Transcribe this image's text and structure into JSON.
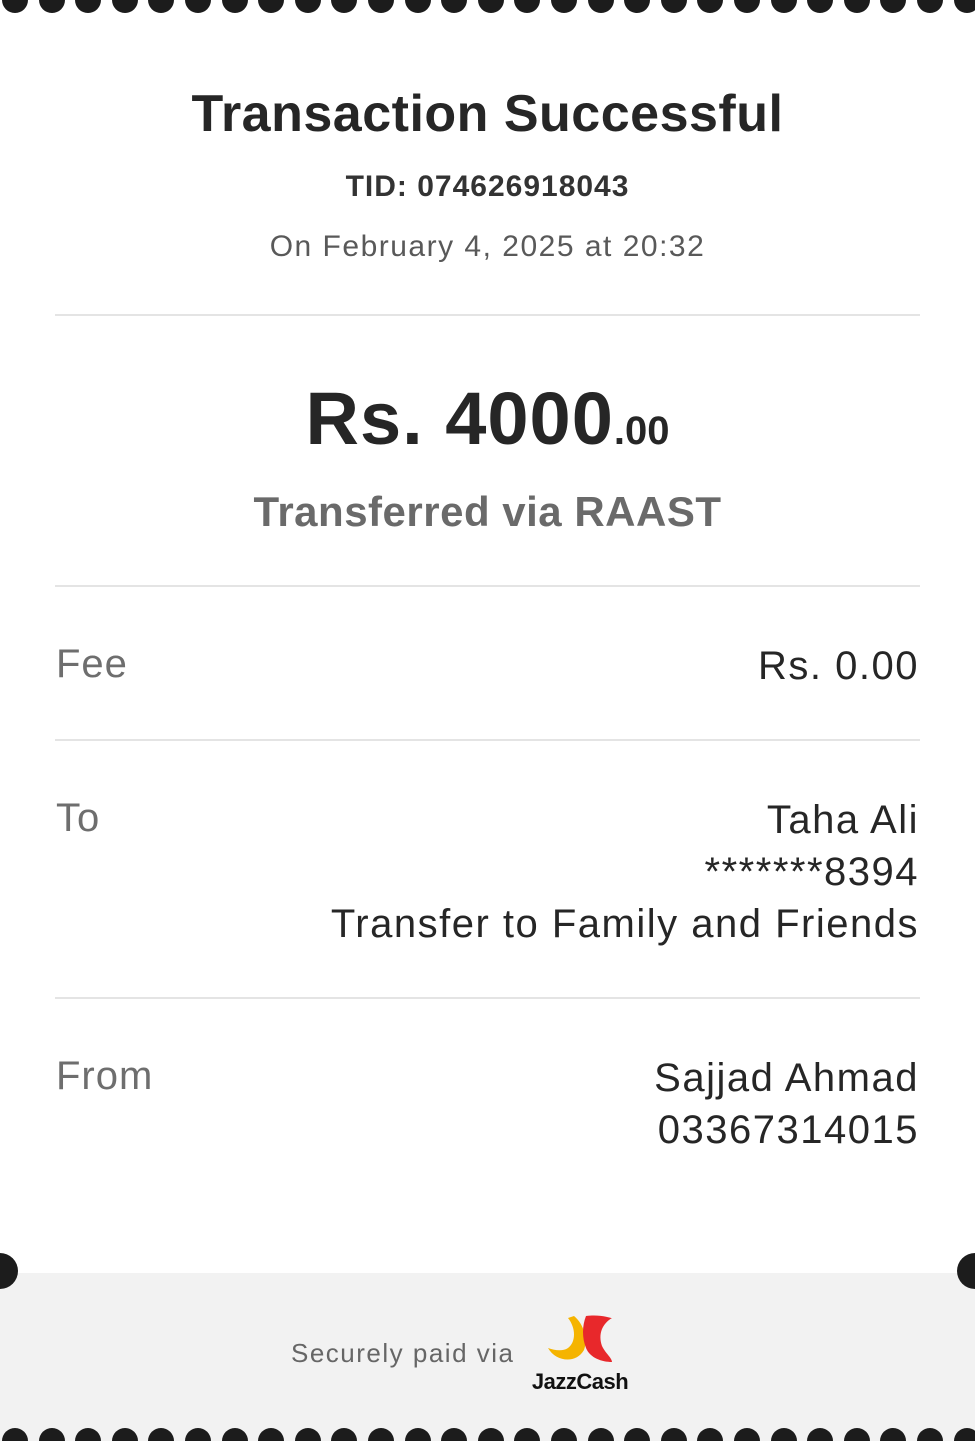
{
  "receipt": {
    "title": "Transaction Successful",
    "tid": "TID: 074626918043",
    "datetime": "On February 4, 2025 at 20:32",
    "amount_main": "Rs. 4000",
    "amount_cents": ".00",
    "method": "Transferred via RAAST"
  },
  "fee": {
    "label": "Fee",
    "value": "Rs. 0.00"
  },
  "to": {
    "label": "To",
    "name": "Taha Ali",
    "account": "*******8394",
    "purpose": "Transfer to Family and Friends"
  },
  "from": {
    "label": "From",
    "name": "Sajjad Ahmad",
    "account": "03367314015"
  },
  "footer": {
    "secure_text": "Securely paid via",
    "brand_name": "JazzCash"
  },
  "colors": {
    "brand_yellow": "#f5b400",
    "brand_red": "#e8282b",
    "perforation": "#1c1c1c",
    "footer_bg": "#f2f2f2"
  }
}
